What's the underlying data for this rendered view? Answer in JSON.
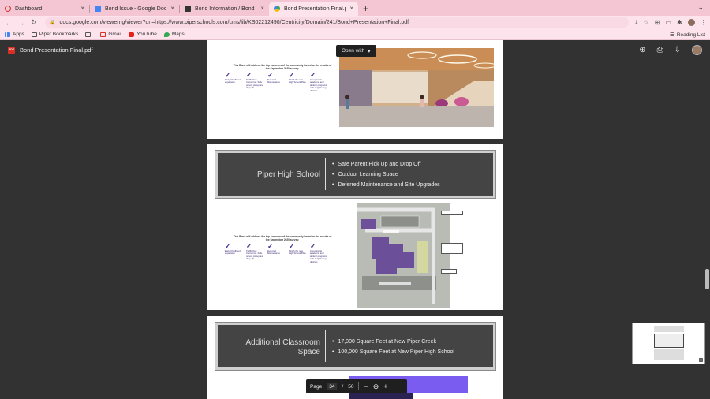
{
  "tabs": [
    {
      "title": "Dashboard",
      "color": "#d93025",
      "active": false
    },
    {
      "title": "Bond Issue - Google Docs",
      "color": "#4285f4",
      "active": false
    },
    {
      "title": "Bond Information / Bond Video",
      "color": "#333333",
      "active": false
    },
    {
      "title": "Bond Presentation Final.pdf",
      "color": "#34a853",
      "active": true
    }
  ],
  "tab_close": "×",
  "new_tab": "+",
  "url": "docs.google.com/viewerng/viewer?url=https://www.piperschools.com/cms/lib/KS02212490/Centricity/Domain/241/Bond+Presentation+Final.pdf",
  "bookmarks": [
    {
      "label": "Apps",
      "icon": "apps-icon"
    },
    {
      "label": "Piper Bookmarks",
      "icon": "folder-icon"
    },
    {
      "label": "Gmail",
      "icon": "gmail-icon"
    },
    {
      "label": "YouTube",
      "icon": "youtube-icon"
    },
    {
      "label": "Maps",
      "icon": "maps-icon"
    }
  ],
  "reading_list": "Reading List",
  "viewer": {
    "file_title": "Bond Presentation Final.pdf",
    "pdf_badge": "PDF",
    "open_with": "Open with",
    "page_label": "Page",
    "page_current": "34",
    "page_sep": "/",
    "page_total": "50"
  },
  "slide_checks": {
    "title": "This Bond will address the top concerns of the community based on the results of the September 2020 survey:",
    "items": [
      "Early Childhood expansion",
      "Traffic flow Concerns - Safe parent pickup and drop off",
      "Deferred Maintenance",
      "Finish the new High School Plan",
      "Comparable academic and athletic programs with neighboring districts"
    ]
  },
  "slide_high_school": {
    "title": "Piper High School",
    "bullets": [
      "Safe Parent Pick Up and Drop Off",
      "Outdoor Learning Space",
      "Deferred Maintenance and Site Upgrades"
    ]
  },
  "slide_classroom": {
    "title_line1": "Additional Classroom",
    "title_line2": "Space",
    "bullets": [
      "17,000 Square Feet at New Piper Creek",
      "100,000 Square Feet at New Piper High School"
    ]
  },
  "colors": {
    "tabstrip": "#f4c6d4",
    "toolbar": "#fde4ec",
    "viewer_bg": "#323232",
    "accent_purple": "#4a2f9a",
    "banner": "#444444"
  }
}
